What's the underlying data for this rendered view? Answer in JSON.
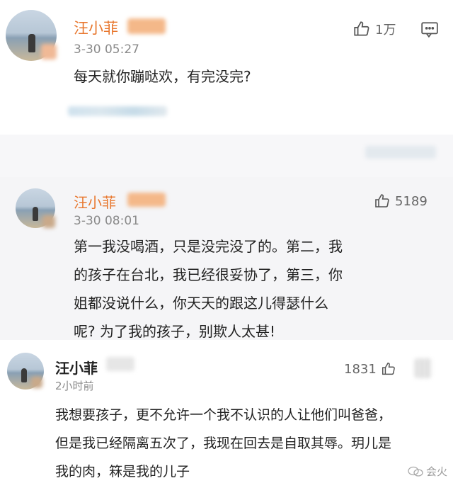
{
  "comments": [
    {
      "name": "汪小菲",
      "time": "3-30 05:27",
      "likes": "1万",
      "text": "每天就你蹦哒欢，有完没完?"
    },
    {
      "name": "汪小菲",
      "time": "3-30 08:01",
      "likes": "5189",
      "lines": [
        "第一我没喝酒，只是没完没了的。第二，我",
        "的孩子在台北，我已经很妥协了，第三，你",
        "姐都没说什么，你天天的跟这儿得瑟什么",
        "呢? 为了我的孩子，别欺人太甚!"
      ]
    },
    {
      "name": "汪小菲",
      "time": "2小时前",
      "likes": "1831",
      "lines": [
        "我想要孩子，更不允许一个我不认识的人让他们叫爸爸，",
        "但是我已经隔离五次了，我现在回去是自取其辱。玥儿是",
        "我的肉，箖是我的儿子"
      ]
    }
  ],
  "watermark": "会火",
  "colors": {
    "name_accent": "#e8772e",
    "text": "#222222",
    "muted": "#8a8a8a"
  }
}
